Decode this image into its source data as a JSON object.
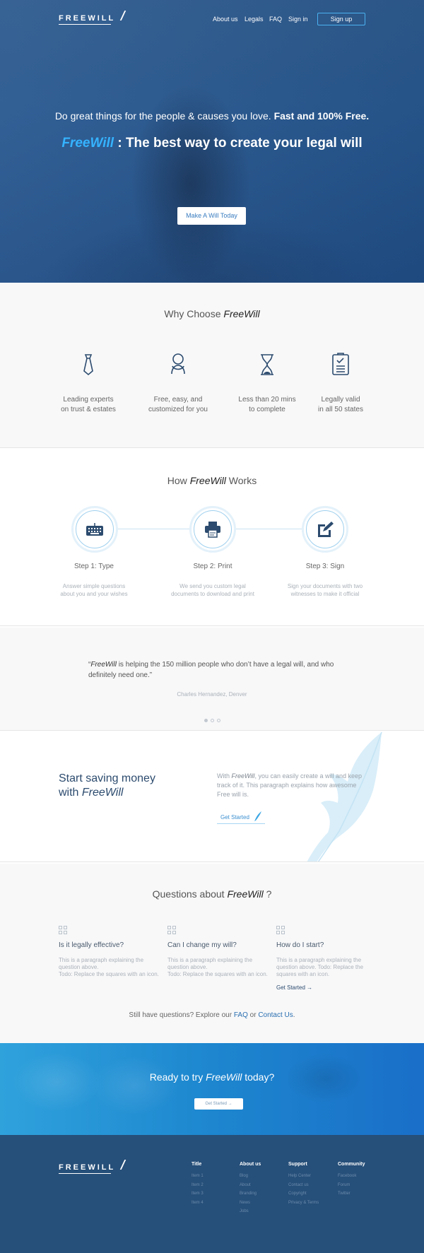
{
  "nav": {
    "logo": "FREEWILL",
    "links": [
      "About us",
      "Legals",
      "FAQ",
      "Sign in"
    ],
    "signup": "Sign up"
  },
  "hero": {
    "tagline_plain": "Do great things for the people & causes you love.",
    "tagline_bold": "Fast and 100% Free.",
    "title_brand": "FreeWill",
    "title_rest": " : The best way to create your legal will",
    "cta": "Make A Will Today"
  },
  "why": {
    "title_plain": "Why Choose ",
    "title_brand": "FreeWill",
    "features": [
      {
        "icon": "tie-icon",
        "line1": "Leading experts",
        "line2": "on trust & estates"
      },
      {
        "icon": "person-icon",
        "line1": "Free, easy, and",
        "line2": "customized for you"
      },
      {
        "icon": "hourglass-icon",
        "line1": "Less than 20 mins",
        "line2": "to complete"
      },
      {
        "icon": "checklist-icon",
        "line1": "Legally valid",
        "line2": "in all 50 states"
      }
    ]
  },
  "how": {
    "title_plain1": "How ",
    "title_brand": "FreeWill",
    "title_plain2": " Works",
    "steps": [
      {
        "icon": "keyboard-icon",
        "title": "Step 1: Type",
        "desc1": "Answer simple questions",
        "desc2": "about you and your wishes"
      },
      {
        "icon": "printer-icon",
        "title": "Step 2: Print",
        "desc1": "We send you custom legal",
        "desc2": "documents to download and print"
      },
      {
        "icon": "sign-icon",
        "title": "Step 3: Sign",
        "desc1": "Sign your documents with two",
        "desc2": "witnesses to make it official"
      }
    ]
  },
  "testimonial": {
    "open": "“",
    "brand": "FreeWill",
    "text": " is helping the 150 million people who don’t have a legal will, and who definitely need one.”",
    "author": "Charles Hernandez, Denver",
    "dots": 3,
    "active_dot": 0
  },
  "save": {
    "title_line1": "Start saving money",
    "title_line2_plain": "with ",
    "title_line2_brand": "FreeWill",
    "text_pre": "With ",
    "text_brand": "FreeWill",
    "text_post": ", you can easily create a will and keep track of it. This paragraph explains how awesome Free will is.",
    "cta": "Get Started"
  },
  "faq": {
    "title_plain": "Questions about ",
    "title_brand": "FreeWill",
    "title_end": " ?",
    "items": [
      {
        "q": "Is it legally effective?",
        "a": "This is a paragraph explaining the question above.",
        "todo": "Todo: Replace the squares with an icon."
      },
      {
        "q": "Can I change my will?",
        "a": "This is a paragraph explaining the question above.",
        "todo": "Todo: Replace the squares with an icon."
      },
      {
        "q": "How do I start?",
        "a": "This is a paragraph explaining the question above. Todo: Replace the squares with an icon.",
        "link": "Get Started"
      }
    ],
    "footer_pre": "Still have questions? Explore our ",
    "footer_faq": "FAQ",
    "footer_or": " or ",
    "footer_contact": "Contact Us",
    "footer_end": "."
  },
  "ready": {
    "title_pre": "Ready to try ",
    "title_brand": "FreeWill",
    "title_post": " today?",
    "cta": "Get Started"
  },
  "footer": {
    "logo": "FREEWILL",
    "columns": [
      {
        "head": "Title",
        "links": [
          "Item 1",
          "Item 2",
          "Item 3",
          "Item 4"
        ]
      },
      {
        "head": "About us",
        "links": [
          "Blog",
          "About",
          "Branding",
          "News",
          "Jobs"
        ]
      },
      {
        "head": "Support",
        "links": [
          "Help Center",
          "Contact us",
          "Copyright",
          "Privacy & Terms"
        ]
      },
      {
        "head": "Community",
        "links": [
          "Facebook",
          "Forum",
          "Twitter"
        ]
      }
    ]
  },
  "colors": {
    "hero_bg": "#27578f",
    "brand_blue": "#35b3ff",
    "navy": "#2c4b6e",
    "footer_bg": "#264f79"
  }
}
